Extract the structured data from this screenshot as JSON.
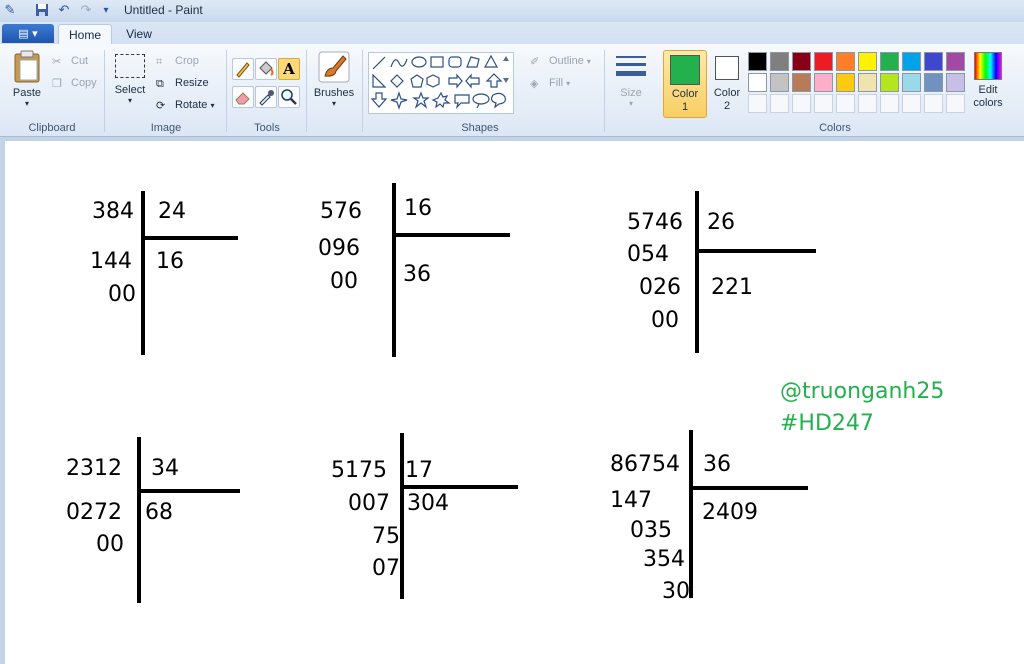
{
  "window": {
    "title": "Untitled - Paint"
  },
  "tabs": {
    "home": "Home",
    "view": "View"
  },
  "file_menu": {
    "icon": "paint-menu-icon"
  },
  "clipboard": {
    "label": "Clipboard",
    "paste": "Paste",
    "cut": "Cut",
    "copy": "Copy"
  },
  "image": {
    "label": "Image",
    "select": "Select",
    "crop": "Crop",
    "resize": "Resize",
    "rotate": "Rotate"
  },
  "tools": {
    "label": "Tools"
  },
  "brushes": {
    "label": "Brushes"
  },
  "shapes": {
    "label": "Shapes",
    "outline": "Outline",
    "fill": "Fill"
  },
  "size": {
    "label": "Size"
  },
  "colors": {
    "label": "Colors",
    "color1_label": "Color 1",
    "color2_label": "Color 2",
    "edit_label": "Edit colors",
    "color1_value": "#22b14c",
    "color2_value": "#ffffff",
    "palette_row1": [
      "#000000",
      "#7f7f7f",
      "#880015",
      "#ed1c24",
      "#ff7f27",
      "#fff200",
      "#22b14c",
      "#00a2e8",
      "#3f48cc",
      "#a349a4"
    ],
    "palette_row2": [
      "#ffffff",
      "#c3c3c3",
      "#b97a57",
      "#ffaec9",
      "#ffc90e",
      "#efe4b0",
      "#b5e61d",
      "#99d9ea",
      "#7092be",
      "#c8bfe7"
    ]
  },
  "divisions": [
    {
      "dividend": "384",
      "divisor": "24",
      "quotient": "16",
      "steps": [
        "144",
        "00"
      ]
    },
    {
      "dividend": "576",
      "divisor": "16",
      "quotient": "36",
      "steps": [
        "096",
        "00"
      ]
    },
    {
      "dividend": "5746",
      "divisor": "26",
      "quotient": "221",
      "steps": [
        "054",
        "026",
        "00"
      ]
    },
    {
      "dividend": "2312",
      "divisor": "34",
      "quotient": "68",
      "steps": [
        "0272",
        "00"
      ]
    },
    {
      "dividend": "5175",
      "divisor": "17",
      "quotient": "304",
      "steps": [
        "007",
        "75",
        "07"
      ]
    },
    {
      "dividend": "86754",
      "divisor": "36",
      "quotient": "2409",
      "steps": [
        "147",
        "035",
        "354",
        "30"
      ]
    }
  ],
  "watermark": {
    "line1": "@truonganh25",
    "line2": "#HD247"
  }
}
